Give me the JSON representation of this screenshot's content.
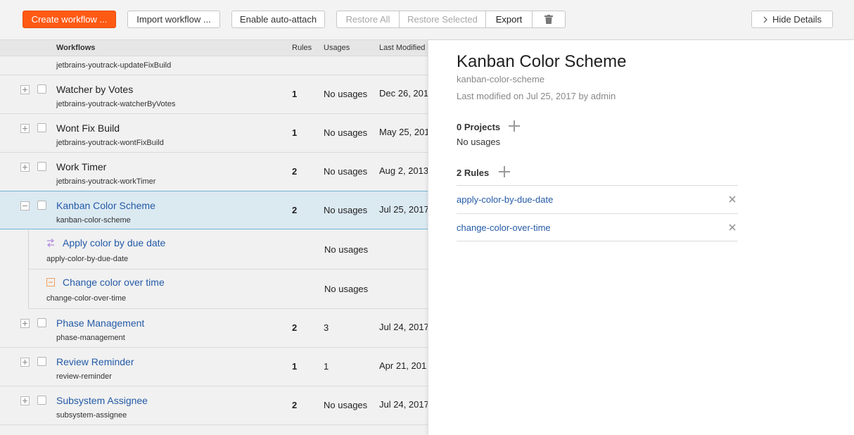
{
  "toolbar": {
    "create_label": "Create workflow ...",
    "import_label": "Import workflow ...",
    "auto_attach_label": "Enable auto-attach",
    "restore_all_label": "Restore All",
    "restore_selected_label": "Restore Selected",
    "export_label": "Export",
    "delete_icon": "trash-icon",
    "hide_details_label": "Hide Details",
    "accent_color": "#ff5a14"
  },
  "table": {
    "headers": {
      "name": "Workflows",
      "rules": "Rules",
      "usages": "Usages",
      "modified": "Last Modified"
    },
    "partial_row_id": "jetbrains-youtrack-updateFixBuild",
    "rows": [
      {
        "name": "Watcher by Votes",
        "id": "jetbrains-youtrack-watcherByVotes",
        "rules": "1",
        "usages": "No usages",
        "modified": "Dec 26, 201"
      },
      {
        "name": "Wont Fix Build",
        "id": "jetbrains-youtrack-wontFixBuild",
        "rules": "1",
        "usages": "No usages",
        "modified": "May 25, 201"
      },
      {
        "name": "Work Timer",
        "id": "jetbrains-youtrack-workTimer",
        "rules": "2",
        "usages": "No usages",
        "modified": "Aug 2, 2013"
      },
      {
        "name": "Kanban Color Scheme",
        "id": "kanban-color-scheme",
        "rules": "2",
        "usages": "No usages",
        "modified": "Jul 25, 2017"
      },
      {
        "name": "Phase Management",
        "id": "phase-management",
        "rules": "2",
        "usages": "3",
        "modified": "Jul 24, 2017"
      },
      {
        "name": "Review Reminder",
        "id": "review-reminder",
        "rules": "1",
        "usages": "1",
        "modified": "Apr 21, 201"
      },
      {
        "name": "Subsystem Assignee",
        "id": "subsystem-assignee",
        "rules": "2",
        "usages": "No usages",
        "modified": "Jul 24, 2017"
      }
    ],
    "subrows": [
      {
        "name": "Apply color by due date",
        "id": "apply-color-by-due-date",
        "usages": "No usages",
        "icon": "on-change-rule-icon"
      },
      {
        "name": "Change color over time",
        "id": "change-color-over-time",
        "usages": "No usages",
        "icon": "on-schedule-rule-icon"
      }
    ]
  },
  "details": {
    "title": "Kanban Color Scheme",
    "id": "kanban-color-scheme",
    "modified": "Last modified on Jul 25, 2017 by admin",
    "projects_heading": "0 Projects",
    "projects_text": "No usages",
    "rules_heading": "2 Rules",
    "rules": [
      {
        "label": "apply-color-by-due-date"
      },
      {
        "label": "change-color-over-time"
      }
    ],
    "link_color": "#245aa7"
  }
}
